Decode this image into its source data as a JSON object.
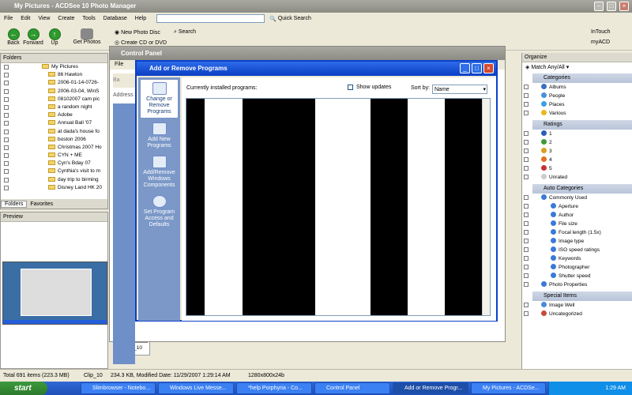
{
  "main_window": {
    "title": "My Pictures - ACDSee 10 Photo Manager",
    "menu": [
      "File",
      "Edit",
      "View",
      "Create",
      "Tools",
      "Database",
      "Help"
    ],
    "quick_search": "Quick Search",
    "toolbar": {
      "back": "Back",
      "forward": "Forward",
      "up": "Up",
      "get_photos": "Get Photos",
      "new_photo_disc": "New Photo Disc",
      "create_cd": "Create CD or DVD",
      "search": "Search",
      "intouch": "InTouch",
      "myacd": "myACD"
    }
  },
  "folders_panel": {
    "title": "Folders",
    "items": [
      "My Pictures",
      "86 Hawton",
      "2006-01-14-0726-",
      "2006-03-04, WinS",
      "08102007 cam pic",
      "a random night",
      "Adobe",
      "Annual Ball '07",
      "at dada's house fo",
      "boston 2006",
      "Christmas 2007 Ho",
      "CYN + ME",
      "Cyn's Bday 07",
      "Cynthia's visit to m",
      "day trip to birming",
      "Disney Land HK 20"
    ],
    "tabs": [
      "Folders",
      "Favorites"
    ]
  },
  "preview_panel": {
    "title": "Preview"
  },
  "thumbnail_label": "Clip_10",
  "control_panel": {
    "title": "Control Panel",
    "menu_first": "File",
    "address": "Address",
    "back": "Ba"
  },
  "add_remove": {
    "title": "Add or Remove Programs",
    "side": [
      {
        "label": "Change or Remove Programs"
      },
      {
        "label": "Add New Programs"
      },
      {
        "label": "Add/Remove Windows Components"
      },
      {
        "label": "Set Program Access and Defaults"
      }
    ],
    "installed_label": "Currently installed programs:",
    "show_updates": "Show updates",
    "sort_by": "Sort by:",
    "sort_value": "Name"
  },
  "organize_panel": {
    "title": "Organize",
    "match": "Match Any/All",
    "categories_title": "Categories",
    "categories": [
      "Albums",
      "People",
      "Places",
      "Various"
    ],
    "ratings_title": "Ratings",
    "ratings": [
      "1",
      "2",
      "3",
      "4",
      "5",
      "Unrated"
    ],
    "auto_title": "Auto Categories",
    "auto": [
      "Commonly Used",
      "Aperture",
      "Author",
      "File size",
      "Focal length (1.5x)",
      "Image type",
      "ISO speed ratings",
      "Keywords",
      "Photographer",
      "Shutter speed",
      "Photo Properties"
    ],
    "special_title": "Special Items",
    "special": [
      "Image Well",
      "Uncategorized"
    ]
  },
  "status": {
    "total": "Total 691 items  (223.3 MB)",
    "item": "Clip_10",
    "info": "234.3 KB, Modified Date: 11/29/2007 1:29:14 AM",
    "dims": "1280x800x24b"
  },
  "taskbar": {
    "start": "start",
    "tasks": [
      "Slimbrowser - Notebo...",
      "Windows Live Messe...",
      "*help Porphyria - Co...",
      "Control Panel",
      "Add or Remove Progr...",
      "My Pictures - ACDSe..."
    ],
    "time": "1:29 AM"
  },
  "colors": {
    "xp_blue": "#0a3fc4",
    "taskbar": "#2457c9",
    "start_green": "#2d7a2d"
  }
}
